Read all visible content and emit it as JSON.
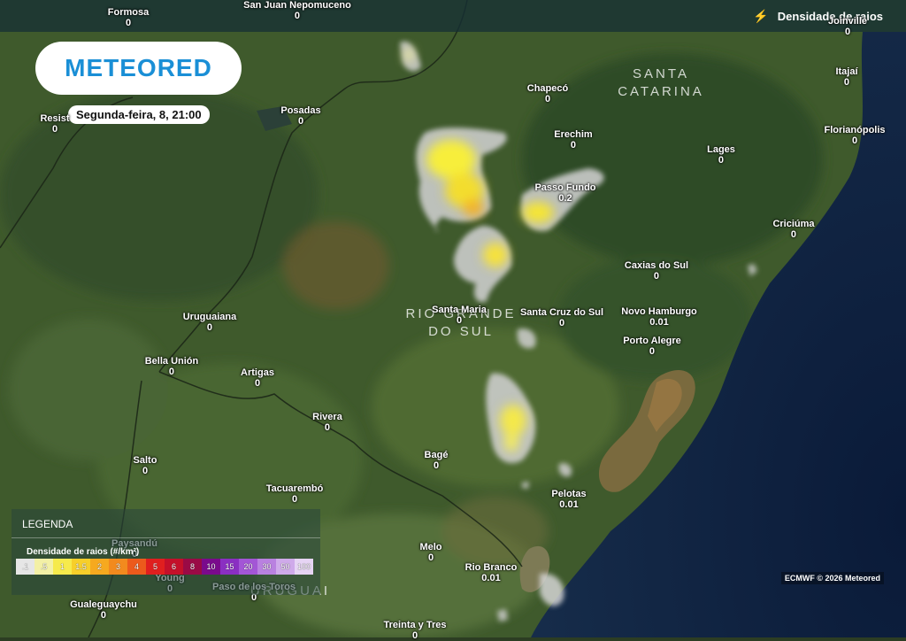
{
  "header": {
    "layer_title": "Densidade de raios",
    "layer_icon": "lightning-icon"
  },
  "logo": {
    "text": "METEORED"
  },
  "date": "Segunda-feira, 8, 21:00",
  "regions": [
    {
      "id": "santa-catarina",
      "lines": [
        "SANTA",
        "CATARINA"
      ]
    },
    {
      "id": "rio-grande-do-sul",
      "lines": [
        "RIO GRANDE",
        "DO SUL"
      ]
    },
    {
      "id": "uruguai",
      "lines": [
        "URUGUAI"
      ]
    }
  ],
  "cities": [
    {
      "name": "Formosa",
      "value": "0"
    },
    {
      "name": "San Juan Nepomuceno",
      "value": "0"
    },
    {
      "name": "Joinville",
      "value": "0"
    },
    {
      "name": "Resist",
      "value": "0"
    },
    {
      "name": "Posadas",
      "value": "0"
    },
    {
      "name": "Chapecó",
      "value": "0"
    },
    {
      "name": "Itajaí",
      "value": "0"
    },
    {
      "name": "Florianópolis",
      "value": "0"
    },
    {
      "name": "Erechim",
      "value": "0"
    },
    {
      "name": "Lages",
      "value": "0"
    },
    {
      "name": "Passo Fundo",
      "value": "0.2"
    },
    {
      "name": "Criciúma",
      "value": "0"
    },
    {
      "name": "Caxias do Sul",
      "value": "0"
    },
    {
      "name": "Uruguaiana",
      "value": "0"
    },
    {
      "name": "Santa Maria",
      "value": "0"
    },
    {
      "name": "Santa Cruz do Sul",
      "value": "0"
    },
    {
      "name": "Novo Hamburgo",
      "value": "0.01"
    },
    {
      "name": "Porto Alegre",
      "value": "0"
    },
    {
      "name": "Bella Unión",
      "value": "0"
    },
    {
      "name": "Artigas",
      "value": "0"
    },
    {
      "name": "Rivera",
      "value": "0"
    },
    {
      "name": "Salto",
      "value": "0"
    },
    {
      "name": "Bagé",
      "value": "0"
    },
    {
      "name": "Tacuarembó",
      "value": "0"
    },
    {
      "name": "Pelotas",
      "value": "0.01"
    },
    {
      "name": "Paysandú",
      "value": "0"
    },
    {
      "name": "Melo",
      "value": "0"
    },
    {
      "name": "Young",
      "value": "0"
    },
    {
      "name": "Paso de los Toros",
      "value": "0"
    },
    {
      "name": "Rio Branco",
      "value": "0.01"
    },
    {
      "name": "Gualeguaychu",
      "value": "0"
    },
    {
      "name": "Treinta y Tres",
      "value": "0"
    }
  ],
  "legend": {
    "title": "LEGENDA",
    "subtitle": "Densidade de raios (#/km²)",
    "scale": [
      {
        "label": ".1",
        "color": "#e6e6e6"
      },
      {
        "label": ".5",
        "color": "#f3f0a6"
      },
      {
        "label": "1",
        "color": "#f6ea4c"
      },
      {
        "label": "1.5",
        "color": "#f7cf2a"
      },
      {
        "label": "2",
        "color": "#f6a91f"
      },
      {
        "label": "3",
        "color": "#f28a1e"
      },
      {
        "label": "4",
        "color": "#ec5a1c"
      },
      {
        "label": "5",
        "color": "#e01f1f"
      },
      {
        "label": "6",
        "color": "#c4102a"
      },
      {
        "label": "8",
        "color": "#9a0a45"
      },
      {
        "label": "10",
        "color": "#7a0a8c"
      },
      {
        "label": "15",
        "color": "#8a2fc2"
      },
      {
        "label": "20",
        "color": "#a356d6"
      },
      {
        "label": "30",
        "color": "#b981e0"
      },
      {
        "label": "50",
        "color": "#cfaaea"
      },
      {
        "label": "100",
        "color": "#e6d4f4"
      }
    ]
  },
  "credit": "ECMWF © 2026 Meteored"
}
